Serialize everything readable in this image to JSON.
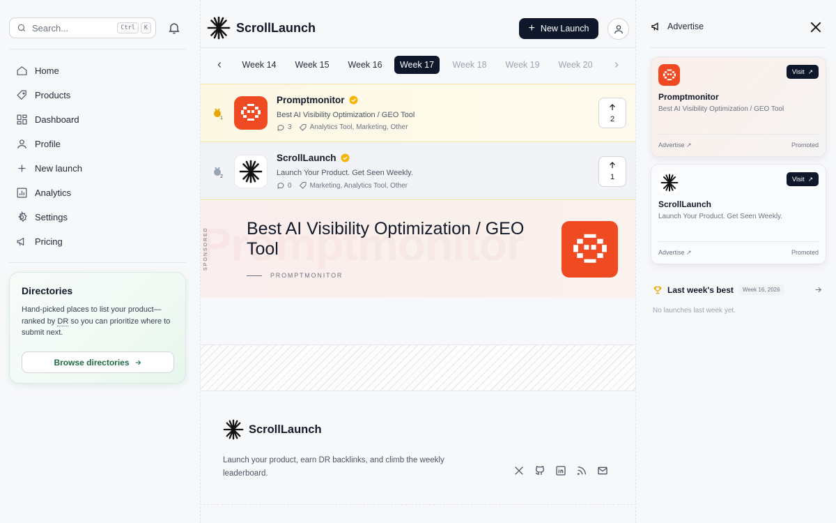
{
  "search": {
    "placeholder": "Search...",
    "kbd1": "Ctrl",
    "kbd2": "K"
  },
  "sidebar": {
    "items": [
      {
        "label": "Home",
        "icon": "home-icon"
      },
      {
        "label": "Products",
        "icon": "tag-icon"
      },
      {
        "label": "Dashboard",
        "icon": "grid-icon"
      },
      {
        "label": "Profile",
        "icon": "user-icon"
      },
      {
        "label": "New launch",
        "icon": "plus-icon"
      },
      {
        "label": "Analytics",
        "icon": "bar-chart-icon"
      },
      {
        "label": "Settings",
        "icon": "gear-icon"
      },
      {
        "label": "Pricing",
        "icon": "megaphone-icon"
      }
    ]
  },
  "directories": {
    "title": "Directories",
    "desc_1": "Hand-picked places to list your product—ranked by ",
    "desc_dr": "DR",
    "desc_2": " so you can prioritize where to submit next.",
    "button": "Browse directories"
  },
  "header": {
    "brand": "ScrollLaunch",
    "new_launch": "New Launch"
  },
  "weeks": {
    "items": [
      "Week 14",
      "Week 15",
      "Week 16",
      "Week 17",
      "Week 18",
      "Week 19",
      "Week 20"
    ],
    "active": "Week 17"
  },
  "products": [
    {
      "rank": "1",
      "name": "Promptmonitor",
      "tagline": "Best AI Visibility Optimization / GEO Tool",
      "comments": "3",
      "tags": "Analytics Tool, Marketing, Other",
      "votes": "2"
    },
    {
      "rank": "2",
      "name": "ScrollLaunch",
      "tagline": "Launch Your Product. Get Seen Weekly.",
      "comments": "0",
      "tags": "Marketing, Analytics Tool, Other",
      "votes": "1"
    }
  ],
  "sponsored": {
    "label": "SPONSORED",
    "ghost": "Promptmonitor",
    "headline": "Best AI Visibility Optimization / GEO Tool",
    "brand": "PROMPTMONITOR"
  },
  "footer": {
    "brand": "ScrollLaunch",
    "tagline": "Launch your product, earn DR backlinks, and climb the weekly leaderboard."
  },
  "right": {
    "advertise": "Advertise",
    "ads": [
      {
        "name": "Promptmonitor",
        "tagline": "Best AI Visibility Optimization / GEO Tool",
        "visit": "Visit",
        "foot_left": "Advertise",
        "foot_right": "Promoted"
      },
      {
        "name": "ScrollLaunch",
        "tagline": "Launch Your Product. Get Seen Weekly.",
        "visit": "Visit",
        "foot_left": "Advertise",
        "foot_right": "Promoted"
      }
    ],
    "last_week": {
      "title": "Last week's best",
      "badge": "Week 16, 2026",
      "empty": "No launches last week yet."
    }
  },
  "colors": {
    "accent_dark": "#0f172a",
    "brand_orange": "#f04a23",
    "verified": "#f5b400",
    "directory_green": "#1e6a43"
  }
}
